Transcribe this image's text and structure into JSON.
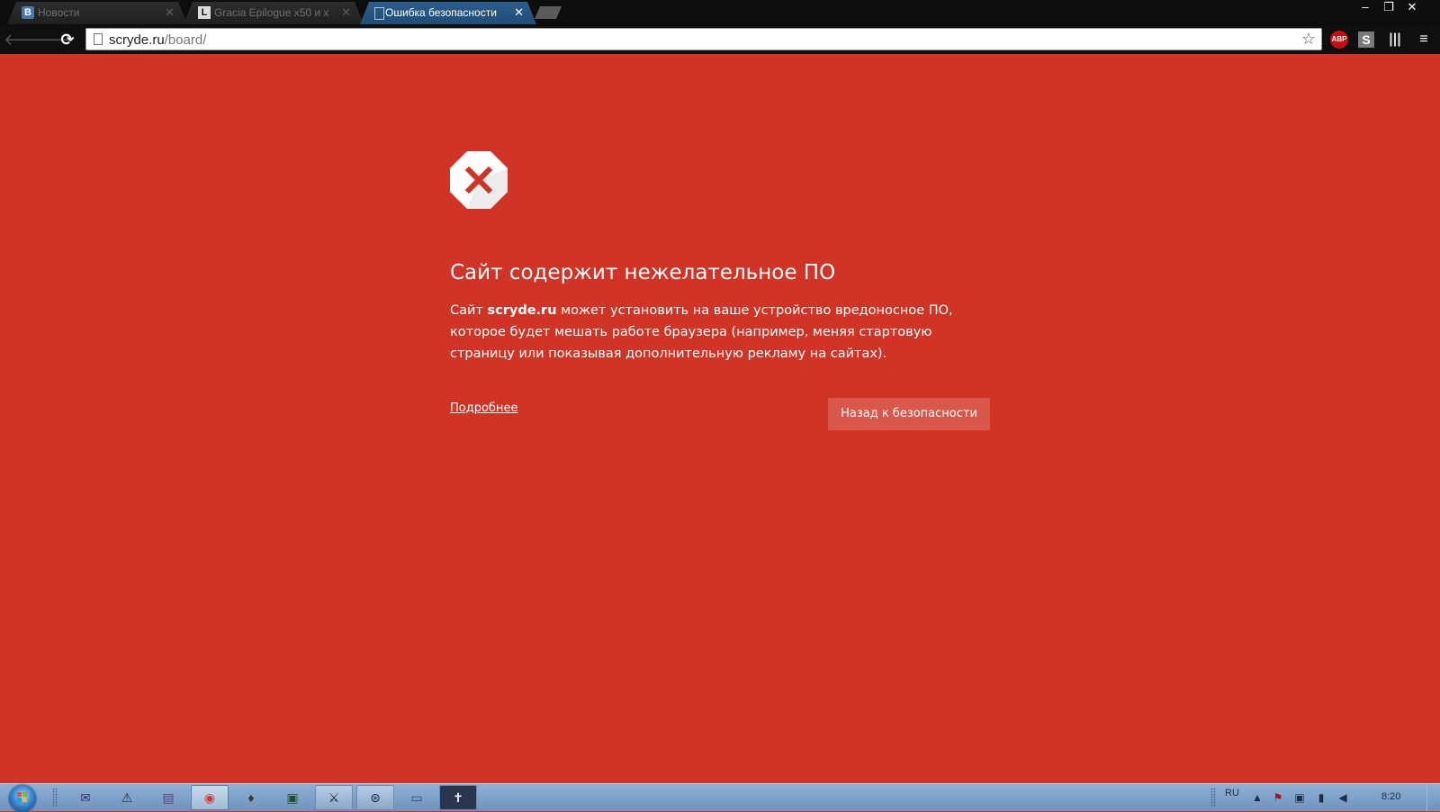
{
  "browser": {
    "tabs": [
      {
        "favicon": "В",
        "title": "Новости",
        "active": false
      },
      {
        "favicon": "L",
        "title": "Gracia Epilogue x50 и х",
        "active": false
      },
      {
        "favicon": "",
        "title": "Ошибка безопасности",
        "active": true
      }
    ],
    "tab_close_glyph": "✕",
    "window_buttons": {
      "minimize": "–",
      "restore": "❐",
      "close": "✕"
    },
    "nav": {
      "back": "🡐",
      "forward": "🡒",
      "reload": "⟳"
    },
    "url_host": "scryde.ru",
    "url_path": "/board/",
    "bookmark_star": "☆",
    "extensions": {
      "abp": "ABP",
      "s": "S",
      "bars": "|||",
      "menu": "≡"
    }
  },
  "interstitial": {
    "icon": "stop-icon",
    "heading": "Сайт содержит нежелательное ПО",
    "body_prefix": "Сайт ",
    "site_name": "scryde.ru",
    "body_suffix": " может установить на ваше устройство вредоносное ПО, которое будет мешать работе браузера (например, меняя стартовую страницу или показывая дополнительную рекламу на сайтах).",
    "details_link": "Подробнее",
    "back_button": "Назад к безопасности",
    "colors": {
      "background": "#d03426",
      "button": "#d9574b",
      "icon_x": "#d03426"
    }
  },
  "taskbar": {
    "pinned": [
      {
        "name": "mail-app-icon",
        "glyph": "✉"
      },
      {
        "name": "warning-app-icon",
        "glyph": "⚠"
      },
      {
        "name": "floppy-app-icon",
        "glyph": "▤"
      },
      {
        "name": "chrome-app-icon",
        "glyph": "◉"
      },
      {
        "name": "shield-app-icon",
        "glyph": "♦"
      },
      {
        "name": "terminal-app-icon",
        "glyph": "▣"
      },
      {
        "name": "game-app-icon",
        "glyph": "⚔"
      },
      {
        "name": "steam-app-icon",
        "glyph": "⊛"
      },
      {
        "name": "window-app-icon",
        "glyph": "▭"
      },
      {
        "name": "media-app-icon",
        "glyph": "✝"
      }
    ],
    "language": "RU",
    "clock": "8:20"
  }
}
